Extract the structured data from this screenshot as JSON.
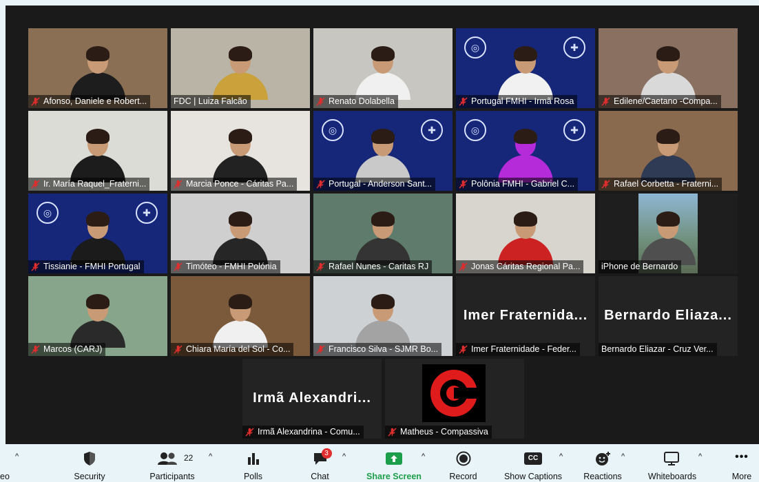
{
  "participants": [
    {
      "name": "Afonso, Daniele e Robert...",
      "muted": true,
      "bg": "#8a6f55",
      "shirt": "#1d1d1d"
    },
    {
      "name": "FDC | Luiza Falcão",
      "muted": false,
      "bg": "#b9b4a6",
      "shirt": "#caa13a",
      "speaking": true
    },
    {
      "name": "Renato Dolabella",
      "muted": true,
      "bg": "#c8c6c1",
      "shirt": "#f0f0f0"
    },
    {
      "name": "Portugal FMHI - Irmã Rosa",
      "muted": true,
      "bg": "#16277a",
      "shirt": "#f1f1f1",
      "logo": true
    },
    {
      "name": "Edilene/Caetano -Compa...",
      "muted": true,
      "bg": "#8a7060",
      "shirt": "#d9d9d9"
    },
    {
      "name": "Ir. María Raquel_Fraterni...",
      "muted": true,
      "bg": "#dcdcd6",
      "shirt": "#1c1c1c"
    },
    {
      "name": "Marcia Ponce - Cáritas Pa...",
      "muted": true,
      "bg": "#e7e4df",
      "shirt": "#222"
    },
    {
      "name": "Portugal - Anderson Sant...",
      "muted": true,
      "bg": "#16277a",
      "shirt": "#c9c9c9",
      "logo": true
    },
    {
      "name": "Polônia FMHI - Gabriel C...",
      "muted": true,
      "bg": "#16277a",
      "shirt": "#b52bd9",
      "logo": true,
      "skin": "#b52bd9"
    },
    {
      "name": "Rafael Corbetta - Fraterni...",
      "muted": true,
      "bg": "#8a6a4e",
      "shirt": "#2f3a55"
    },
    {
      "name": "Tissianie - FMHI Portugal",
      "muted": true,
      "bg": "#16277a",
      "shirt": "#1b1b1b",
      "logo": true
    },
    {
      "name": "Timóteo - FMHI Polónia",
      "muted": true,
      "bg": "#cfcfcf",
      "shirt": "#262626"
    },
    {
      "name": "Rafael Nunes - Caritas RJ",
      "muted": true,
      "bg": "#5f7b6c",
      "shirt": "#343434"
    },
    {
      "name": "Jonas Cáritas Regional Pa...",
      "muted": true,
      "bg": "#d8d5cf",
      "shirt": "#c22"
    },
    {
      "name": "iPhone de Bernardo",
      "muted": false,
      "bg": "#5d8aa8",
      "shirt": "#4f4f4f",
      "portrait": true
    },
    {
      "name": "Marcos (CARJ)",
      "muted": true,
      "bg": "#87a58a",
      "shirt": "#2a2a2a"
    },
    {
      "name": "Chiara María del Sol - Co...",
      "muted": true,
      "bg": "#7a5a3a",
      "shirt": "#f0f0f0"
    },
    {
      "name": "Francisco Silva - SJMR Bo...",
      "muted": true,
      "bg": "#cdd1d4",
      "shirt": "#a3a3a3"
    },
    {
      "name": "Imer Fraternidade - Feder...",
      "muted": true,
      "big": "Imer Fraternida..."
    },
    {
      "name": "Bernardo Eliazar - Cruz Ver...",
      "muted": false,
      "big": "Bernardo Eliaza..."
    },
    {
      "name": "Irmã Alexandrina - Comu...",
      "muted": true,
      "big": "Irmã Alexandri..."
    },
    {
      "name": "Matheus - Compassiva",
      "muted": true,
      "brand": true
    }
  ],
  "toolbar": {
    "left_partial": "eo",
    "security": "Security",
    "participants": "Participants",
    "participant_count": "22",
    "polls": "Polls",
    "chat": "Chat",
    "chat_badge": "3",
    "share": "Share Screen",
    "record": "Record",
    "captions": "Show Captions",
    "cc": "CC",
    "reactions": "Reactions",
    "whiteboards": "Whiteboards",
    "more": "More",
    "more_glyph": "•••"
  },
  "colors": {
    "speaking_outline": "#c5e64a",
    "mute_red": "#e02d2d",
    "share_green": "#1d9e4a",
    "brand_red": "#e01b1b"
  }
}
